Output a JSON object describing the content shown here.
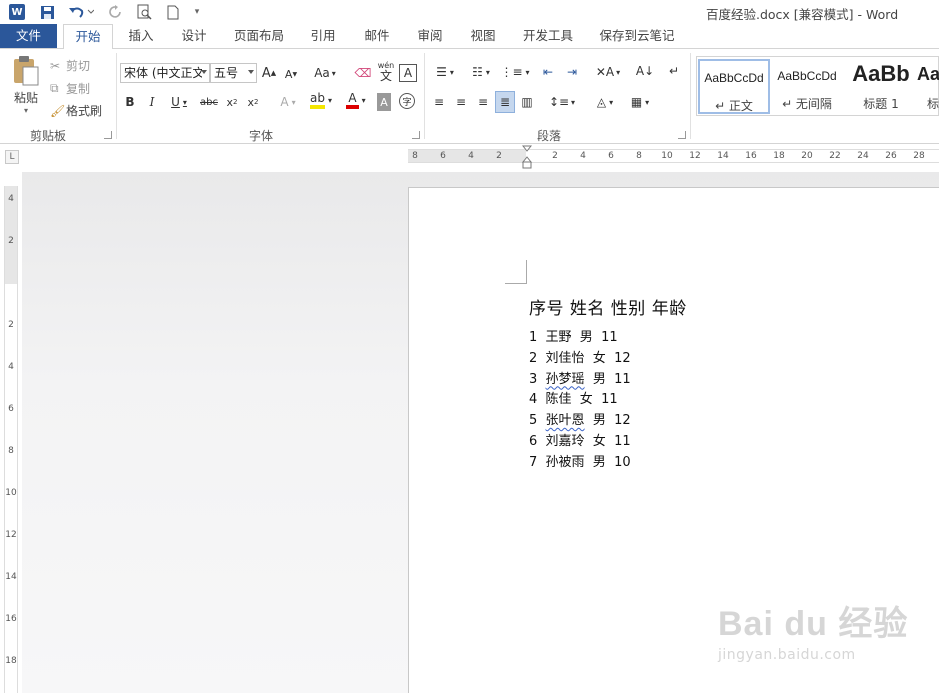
{
  "window": {
    "title": "百度经验.docx [兼容模式] - Word"
  },
  "tabs": [
    "文件",
    "开始",
    "插入",
    "设计",
    "页面布局",
    "引用",
    "邮件",
    "审阅",
    "视图",
    "开发工具",
    "保存到云笔记"
  ],
  "ribbon": {
    "clipboard": {
      "paste": "粘贴",
      "cut": "剪切",
      "copy": "复制",
      "format_painter": "格式刷",
      "label": "剪贴板"
    },
    "font": {
      "name": "宋体 (中文正文",
      "size": "五号",
      "change_case": "Aa",
      "label": "字体",
      "pinyin_top": "wén",
      "pinyin_bottom": "文"
    },
    "paragraph": {
      "label": "段落"
    },
    "styles": [
      {
        "sample": "AaBbCcDd",
        "name": "↵ 正文"
      },
      {
        "sample": "AaBbCcDd",
        "name": "↵ 无间隔"
      },
      {
        "sample": "AaBb",
        "name": "标题 1"
      },
      {
        "sample": "AaB",
        "name": "标"
      }
    ]
  },
  "ruler": {
    "horizontal": [
      "8",
      "6",
      "4",
      "2",
      "2",
      "4",
      "6",
      "8",
      "10",
      "12",
      "14",
      "16",
      "18",
      "20",
      "22",
      "24",
      "26",
      "28"
    ],
    "vertical": [
      "4",
      "2",
      "2",
      "4",
      "6",
      "8",
      "10",
      "12",
      "14",
      "16",
      "18"
    ]
  },
  "document": {
    "header": "序号  姓名  性别  年龄",
    "rows": [
      {
        "text": "1  王野  男  11",
        "spell_error": false
      },
      {
        "text": "2  刘佳怡  女  12",
        "spell_error": false
      },
      {
        "text": "3  孙梦瑶  男  11",
        "spell_error": true,
        "num": "3  ",
        "name": "孙梦瑶",
        "rest": "  男  11"
      },
      {
        "text": "4  陈佳  女  11",
        "spell_error": false
      },
      {
        "text": "5  张叶恩  男  12",
        "spell_error": true,
        "num": "5  ",
        "name": "张叶恩",
        "rest": "  男  12"
      },
      {
        "text": "6  刘嘉玲  女  11",
        "spell_error": false
      },
      {
        "text": "7  孙被雨  男  10",
        "spell_error": false
      }
    ]
  },
  "watermark": {
    "brand": "Bai du 经验",
    "url": "jingyan.baidu.com"
  },
  "colors": {
    "accent": "#2b579a",
    "spell_underline": "#3b63c7"
  }
}
